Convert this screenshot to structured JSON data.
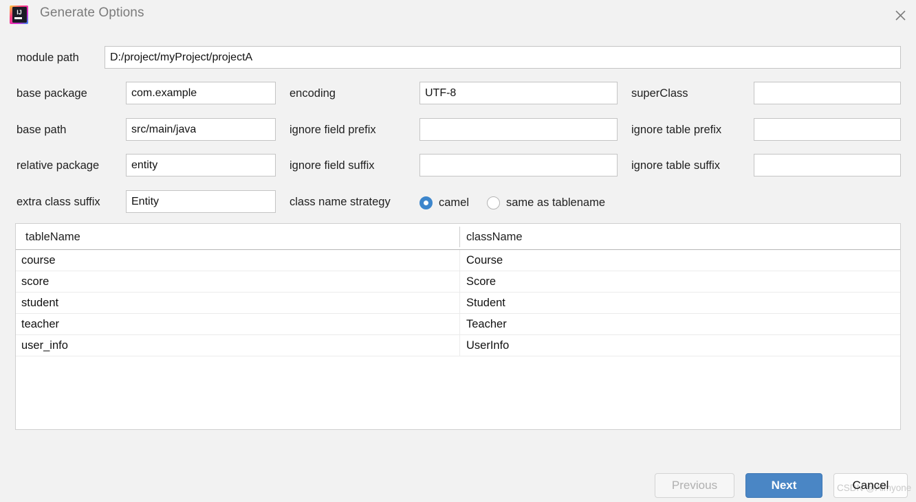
{
  "window": {
    "title": "Generate Options",
    "logo_icon": "intellij-idea-logo",
    "close_icon": "close-icon"
  },
  "form": {
    "module_path": {
      "label": "module path",
      "value": "D:/project/myProject/projectA",
      "placeholder": ""
    },
    "base_package": {
      "label": "base package",
      "value": "com.example",
      "placeholder": ""
    },
    "base_path": {
      "label": "base path",
      "value": "src/main/java",
      "placeholder": ""
    },
    "relative_package": {
      "label": "relative package",
      "value": "entity",
      "placeholder": ""
    },
    "extra_class_suffix": {
      "label": "extra class suffix",
      "value": "Entity",
      "placeholder": ""
    },
    "encoding": {
      "label": "encoding",
      "value": "UTF-8",
      "placeholder": ""
    },
    "ignore_field_prefix": {
      "label": "ignore field prefix",
      "value": "",
      "placeholder": ""
    },
    "ignore_field_suffix": {
      "label": "ignore field suffix",
      "value": "",
      "placeholder": ""
    },
    "super_class": {
      "label": "superClass",
      "value": "",
      "placeholder": ""
    },
    "ignore_table_prefix": {
      "label": "ignore table prefix",
      "value": "",
      "placeholder": ""
    },
    "ignore_table_suffix": {
      "label": "ignore table suffix",
      "value": "",
      "placeholder": ""
    },
    "class_name_strategy": {
      "label": "class name strategy",
      "selected": "camel",
      "options": [
        {
          "value": "camel",
          "label": "camel",
          "checked": true
        },
        {
          "value": "same_as_tablename",
          "label": "same as tablename",
          "checked": false
        }
      ]
    }
  },
  "table": {
    "columns": [
      "tableName",
      "className"
    ],
    "rows": [
      {
        "tableName": "course",
        "className": "Course"
      },
      {
        "tableName": "score",
        "className": "Score"
      },
      {
        "tableName": "student",
        "className": "Student"
      },
      {
        "tableName": "teacher",
        "className": "Teacher"
      },
      {
        "tableName": "user_info",
        "className": "UserInfo"
      }
    ]
  },
  "footer": {
    "previous_label": "Previous",
    "next_label": "Next",
    "cancel_label": "Cancel",
    "watermark": "CSDN @Aimyone"
  },
  "colors": {
    "accent": "#4a86c5",
    "radio_accent": "#3d86cc",
    "background": "#f2f2f2",
    "field_background": "#ffffff",
    "field_border": "#c4c4c4",
    "disabled_text": "#b0b0b0",
    "title_text": "#7b7b7b"
  }
}
